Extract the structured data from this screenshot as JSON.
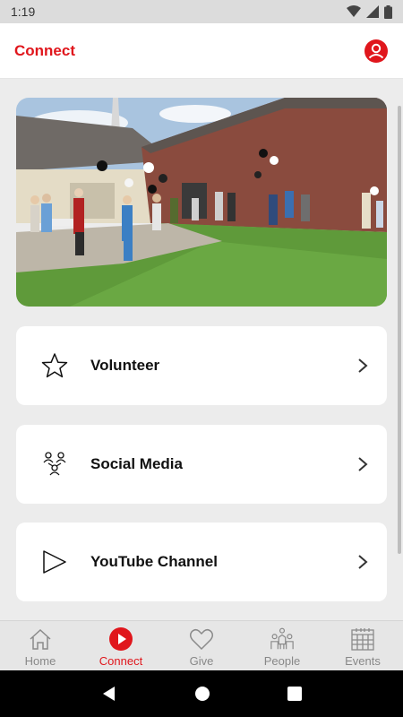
{
  "status_bar": {
    "time": "1:19"
  },
  "header": {
    "title": "Connect"
  },
  "hero": {
    "image": "church-lawn-gathering-photo"
  },
  "cards": [
    {
      "label": "Volunteer",
      "icon": "star-icon"
    },
    {
      "label": "Social Media",
      "icon": "people-network-icon"
    },
    {
      "label": "YouTube Channel",
      "icon": "play-icon"
    }
  ],
  "tabs": [
    {
      "label": "Home",
      "icon": "home-icon",
      "active": false
    },
    {
      "label": "Connect",
      "icon": "play-circle-icon",
      "active": true
    },
    {
      "label": "Give",
      "icon": "heart-icon",
      "active": false
    },
    {
      "label": "People",
      "icon": "people-icon",
      "active": false
    },
    {
      "label": "Events",
      "icon": "calendar-icon",
      "active": false
    }
  ],
  "colors": {
    "accent": "#e0161c",
    "inactive": "#888888",
    "background": "#ececec"
  }
}
